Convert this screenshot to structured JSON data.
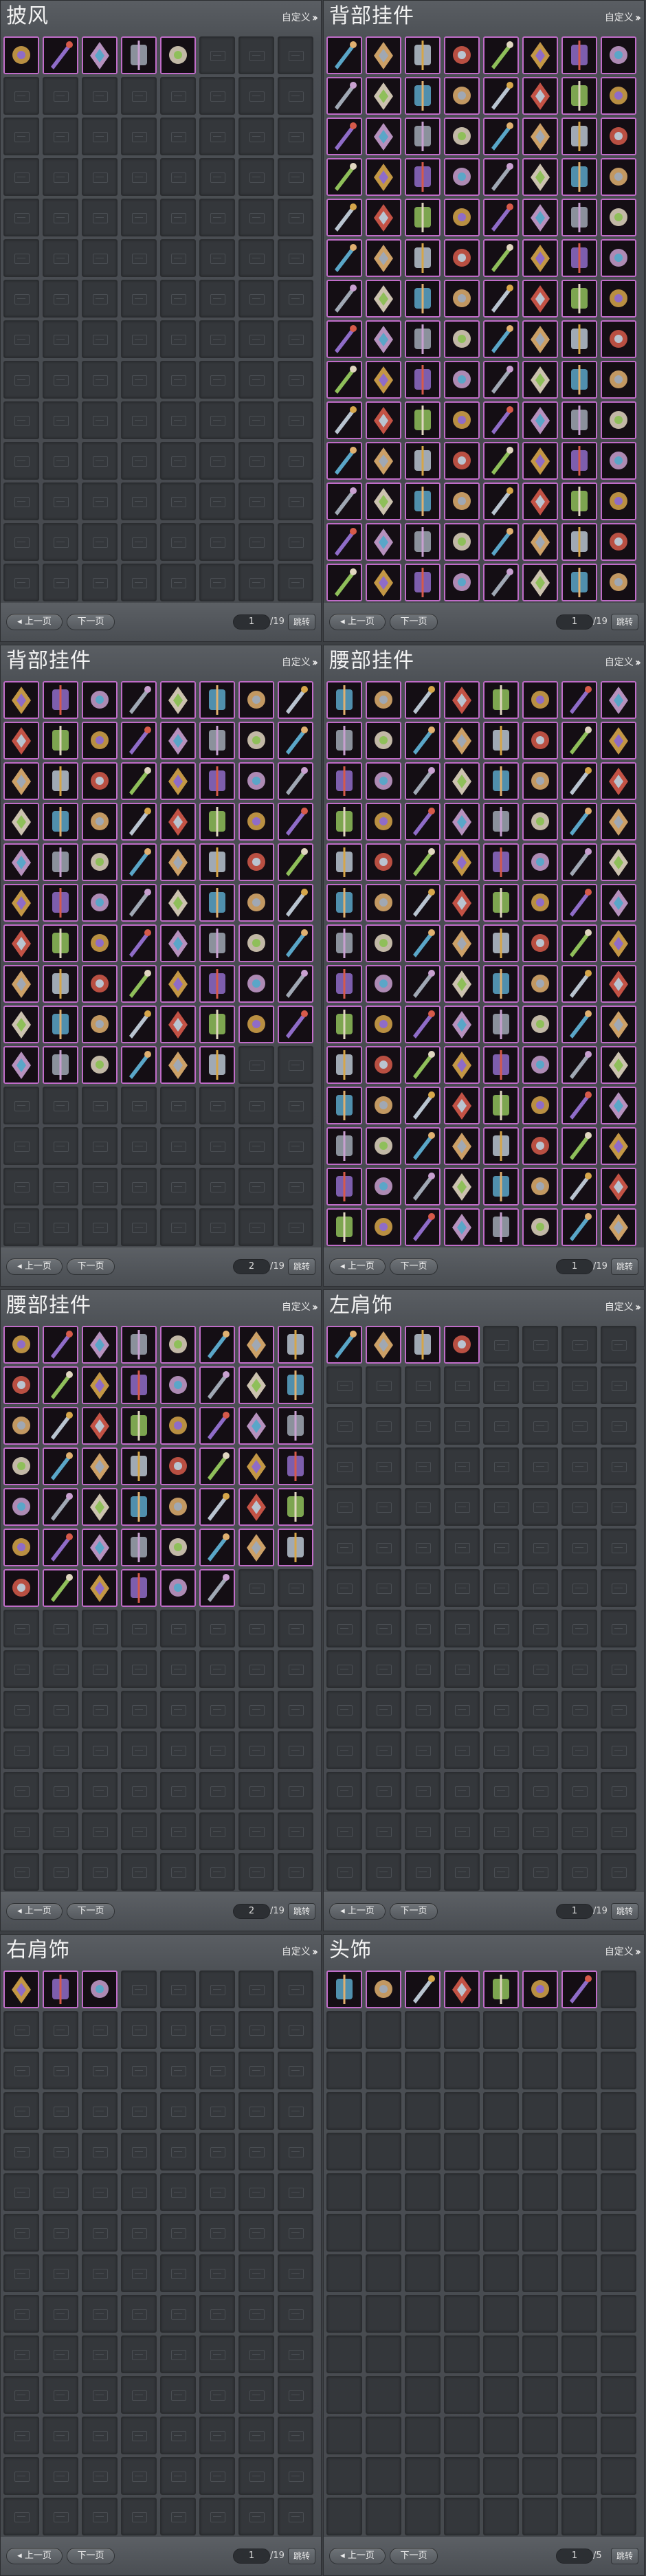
{
  "labels": {
    "custom": "自定义",
    "prev": "上一页",
    "next": "下一页",
    "jump": "跳转"
  },
  "panels": [
    {
      "title": "披风",
      "page": "1",
      "total": "/19",
      "filled": 5,
      "empty_style": "icon"
    },
    {
      "title": "背部挂件",
      "page": "1",
      "total": "/19",
      "filled": 112,
      "empty_style": "icon"
    },
    {
      "title": "背部挂件",
      "page": "2",
      "total": "/19",
      "filled": 78,
      "empty_style": "icon"
    },
    {
      "title": "腰部挂件",
      "page": "1",
      "total": "/19",
      "filled": 112,
      "empty_style": "icon"
    },
    {
      "title": "腰部挂件",
      "page": "2",
      "total": "/19",
      "filled": 54,
      "empty_style": "icon"
    },
    {
      "title": "左肩饰",
      "page": "1",
      "total": "/19",
      "filled": 4,
      "empty_style": "icon"
    },
    {
      "title": "右肩饰",
      "page": "1",
      "total": "/19",
      "filled": 3,
      "empty_style": "icon"
    },
    {
      "title": "头饰",
      "page": "1",
      "total": "/5",
      "filled": 7,
      "empty_style": "plain"
    }
  ],
  "palette": [
    "#d6a64a",
    "#b9c4d0",
    "#e0d6c0",
    "#8f6cc8",
    "#d65a4a",
    "#5aa6c8",
    "#c8a0d0",
    "#8fbf5a",
    "#e0b070",
    "#a0a8b4"
  ]
}
